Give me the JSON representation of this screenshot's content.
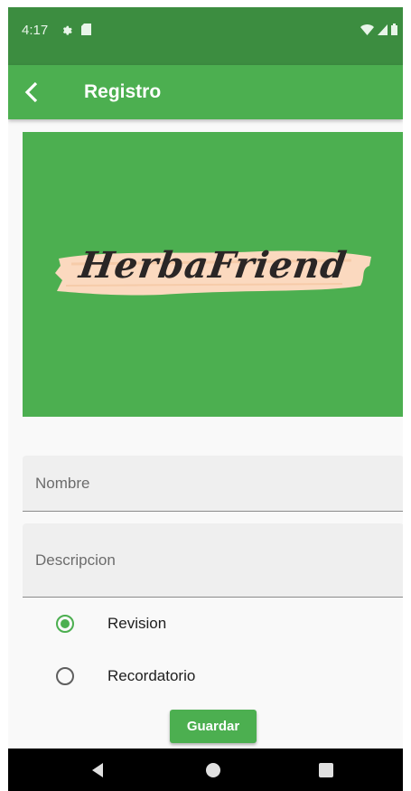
{
  "status_bar": {
    "time": "4:17",
    "left_icons": [
      "gear-icon",
      "sd-card-icon"
    ],
    "right_icons": [
      "wifi-icon",
      "signal-icon",
      "battery-icon"
    ]
  },
  "app_bar": {
    "title": "Registro",
    "back_icon": "chevron-left-icon"
  },
  "logo": {
    "text": "HerbaFriend"
  },
  "form": {
    "nombre_label": "Nombre",
    "descripcion_label": "Descripcion",
    "radio_options": [
      {
        "label": "Revision",
        "selected": true
      },
      {
        "label": "Recordatorio",
        "selected": false
      }
    ],
    "save_label": "Guardar"
  },
  "nav_bar": {
    "icons": [
      "back-triangle-icon",
      "home-circle-icon",
      "recents-square-icon"
    ]
  },
  "colors": {
    "status_bar": "#3c8d40",
    "primary": "#4caf50",
    "logo_stroke": "#fbd9bf",
    "logo_text": "#2a2626",
    "field_bg": "#efefef",
    "nav_bar": "#000000"
  }
}
